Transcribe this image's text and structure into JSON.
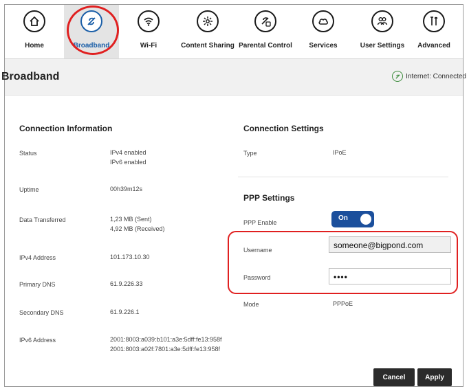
{
  "nav": {
    "items": [
      {
        "label": "Home",
        "icon": "home-icon"
      },
      {
        "label": "Broadband",
        "icon": "broadband-icon"
      },
      {
        "label": "Wi-Fi",
        "icon": "wifi-icon"
      },
      {
        "label": "Content Sharing",
        "icon": "content-sharing-icon"
      },
      {
        "label": "Parental Control",
        "icon": "parental-control-icon"
      },
      {
        "label": "Services",
        "icon": "services-icon"
      },
      {
        "label": "User Settings",
        "icon": "user-settings-icon"
      },
      {
        "label": "Advanced",
        "icon": "advanced-icon"
      }
    ],
    "active": "Broadband"
  },
  "header": {
    "title": "Broadband",
    "status": "Internet: Connected"
  },
  "connection_info": {
    "title": "Connection Information",
    "status_label": "Status",
    "status_line1": "IPv4 enabled",
    "status_line2": "IPv6 enabled",
    "uptime_label": "Uptime",
    "uptime_value": "00h39m12s",
    "data_label": "Data Transferred",
    "data_sent": "1,23 MB (Sent)",
    "data_received": "4,92 MB (Received)",
    "ipv4_label": "IPv4 Address",
    "ipv4_value": "101.173.10.30",
    "primary_dns_label": "Primary DNS",
    "primary_dns_value": "61.9.226.33",
    "secondary_dns_label": "Secondary DNS",
    "secondary_dns_value": "61.9.226.1",
    "ipv6_label": "IPv6 Address",
    "ipv6_line1": "2001:8003:a039:b101:a3e:5dff:fe13:958f",
    "ipv6_line2": "2001:8003:a02f:7801:a3e:5dff:fe13:958f"
  },
  "connection_settings": {
    "title": "Connection Settings",
    "type_label": "Type",
    "type_value": "IPoE"
  },
  "ppp": {
    "title": "PPP Settings",
    "enable_label": "PPP Enable",
    "enable_state": "On",
    "username_label": "Username",
    "username_value": "someone@bigpond.com",
    "password_label": "Password",
    "password_value": "••••",
    "mode_label": "Mode",
    "mode_value": "PPPoE"
  },
  "actions": {
    "cancel": "Cancel",
    "apply": "Apply"
  },
  "colors": {
    "accent": "#1b5fa8",
    "toggle": "#1b4f9c",
    "highlight": "#e02020",
    "button": "#2b2b2b"
  }
}
